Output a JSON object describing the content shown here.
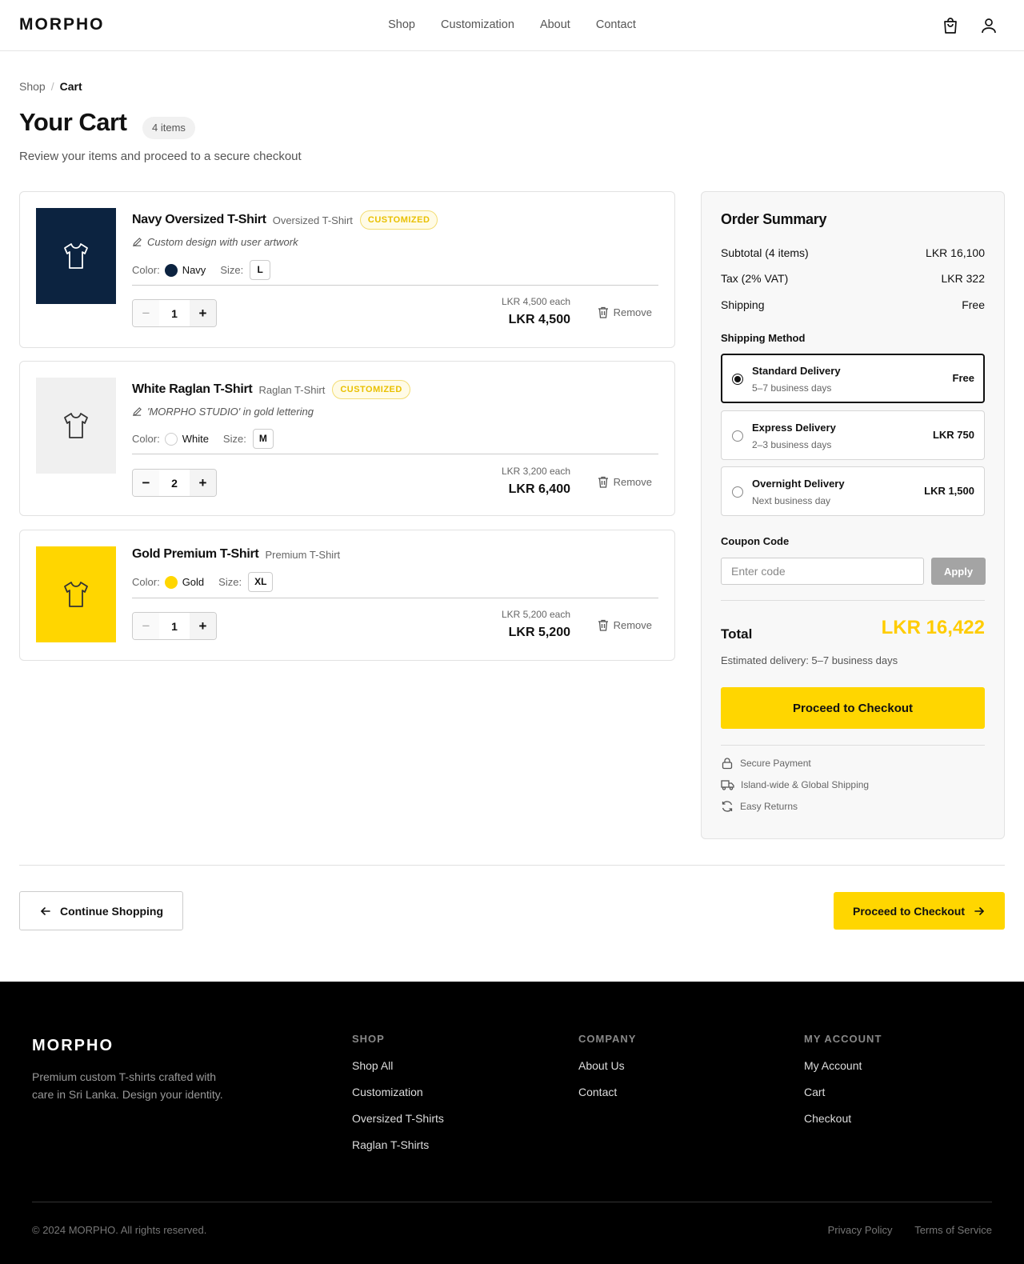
{
  "header": {
    "logo": "MORPHO",
    "nav": [
      "Shop",
      "Customization",
      "About",
      "Contact"
    ],
    "icons": [
      "cart-icon",
      "user-icon"
    ]
  },
  "breadcrumb": {
    "parent": "Shop",
    "separator": "/",
    "current": "Cart"
  },
  "page": {
    "title": "Your Cart",
    "count": "4 items",
    "subtitle": "Review your items and proceed to a secure checkout"
  },
  "labels": {
    "color": "Color:",
    "size": "Size:",
    "remove": "Remove",
    "minus": "−",
    "plus": "+"
  },
  "items": [
    {
      "name": "Navy Oversized T-Shirt",
      "type": "Oversized T-Shirt",
      "badge": "CUSTOMIZED",
      "note": "Custom design with user artwork",
      "color_name": "Navy",
      "color_hex": "#0c2340",
      "size": "L",
      "qty": "1",
      "price_each": "LKR 4,500 each",
      "price_total": "LKR 4,500"
    },
    {
      "name": "White Raglan T-Shirt",
      "type": "Raglan T-Shirt",
      "badge": "CUSTOMIZED",
      "note": "'MORPHO STUDIO' in gold lettering",
      "color_name": "White",
      "color_hex": "#ffffff",
      "size": "M",
      "qty": "2",
      "price_each": "LKR 3,200 each",
      "price_total": "LKR 6,400"
    },
    {
      "name": "Gold Premium T-Shirt",
      "type": "Premium T-Shirt",
      "badge": "",
      "note": "",
      "color_name": "Gold",
      "color_hex": "#ffd600",
      "size": "XL",
      "qty": "1",
      "price_each": "LKR 5,200 each",
      "price_total": "LKR 5,200"
    }
  ],
  "summary": {
    "title": "Order Summary",
    "subtotal_label": "Subtotal (4 items)",
    "subtotal": "LKR 16,100",
    "tax_label": "Tax (2% VAT)",
    "tax": "LKR 322",
    "shipping_label": "Shipping",
    "shipping": "Free",
    "shipping_method_label": "Shipping Method",
    "shipping_options": [
      {
        "name": "Standard Delivery",
        "days": "5–7 business days",
        "price": "Free",
        "selected": true
      },
      {
        "name": "Express Delivery",
        "days": "2–3 business days",
        "price": "LKR 750",
        "selected": false
      },
      {
        "name": "Overnight Delivery",
        "days": "Next business day",
        "price": "LKR 1,500",
        "selected": false
      }
    ],
    "coupon_label": "Coupon Code",
    "coupon_placeholder": "Enter code",
    "coupon_value": "",
    "apply": "Apply",
    "total_label": "Total",
    "total": "LKR 16,422",
    "eta": "Estimated delivery: 5–7 business days",
    "checkout": "Proceed to Checkout",
    "trust": [
      {
        "icon": "lock-icon",
        "text": "Secure Payment"
      },
      {
        "icon": "truck-icon",
        "text": "Island-wide & Global Shipping"
      },
      {
        "icon": "refresh-icon",
        "text": "Easy Returns"
      }
    ]
  },
  "actions": {
    "continue": "Continue Shopping",
    "checkout": "Proceed to Checkout"
  },
  "footer": {
    "logo": "MORPHO",
    "desc": "Premium custom T-shirts crafted with care in Sri Lanka. Design your identity.",
    "columns": [
      {
        "title": "SHOP",
        "links": [
          "Shop All",
          "Customization",
          "Oversized T-Shirts",
          "Raglan T-Shirts"
        ]
      },
      {
        "title": "COMPANY",
        "links": [
          "About Us",
          "Contact"
        ]
      },
      {
        "title": "MY ACCOUNT",
        "links": [
          "My Account",
          "Cart",
          "Checkout"
        ]
      }
    ],
    "copyright": "© 2024 MORPHO. All rights reserved.",
    "legal": [
      "Privacy Policy",
      "Terms of Service"
    ]
  },
  "colors": {
    "accent": "#ffd600",
    "total": "#ffcc00",
    "navy": "#0c2340",
    "thumb_white": "#f0f0f0"
  }
}
